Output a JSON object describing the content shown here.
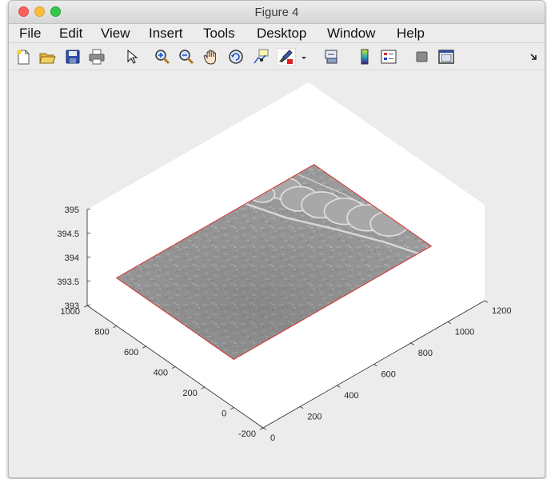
{
  "window": {
    "title": "Figure 4"
  },
  "menu": [
    "File",
    "Edit",
    "View",
    "Insert",
    "Tools",
    "Desktop",
    "Window",
    "Help"
  ],
  "toolbar": {
    "icons": [
      "new-figure-icon",
      "open-file-icon",
      "save-icon",
      "print-icon",
      "edit-plot-arrow-icon",
      "zoom-in-icon",
      "zoom-out-icon",
      "pan-hand-icon",
      "rotate-3d-icon",
      "data-cursor-icon",
      "brush-icon",
      "brush-dropdown-icon",
      "link-plot-icon",
      "colorbar-icon",
      "legend-icon",
      "hide-plot-tools-icon",
      "show-plot-tools-icon",
      "dock-icon"
    ]
  },
  "chart_data": {
    "type": "surface",
    "title": "",
    "xlabel": "",
    "ylabel": "",
    "zlabel": "",
    "x_ticks": [
      "0",
      "200",
      "400",
      "600",
      "800",
      "1000",
      "1200"
    ],
    "y_ticks": [
      "-200",
      "0",
      "200",
      "400",
      "600",
      "800",
      "1000"
    ],
    "z_ticks": [
      "393",
      "393.5",
      "394",
      "394.5",
      "395"
    ],
    "xlim": [
      0,
      1200
    ],
    "ylim": [
      -200,
      1000
    ],
    "zlim": [
      393,
      395
    ],
    "surface_z": 394,
    "surface_extent_x": [
      0,
      1070
    ],
    "surface_extent_y": [
      0,
      800
    ],
    "texture": "grayscale image",
    "edge_color": "#d4312e",
    "grid": false,
    "box": true,
    "colors": {
      "axes_background": "#ffffff",
      "figure_background": "#ececec",
      "texture_base": "#9a9a9a"
    }
  }
}
